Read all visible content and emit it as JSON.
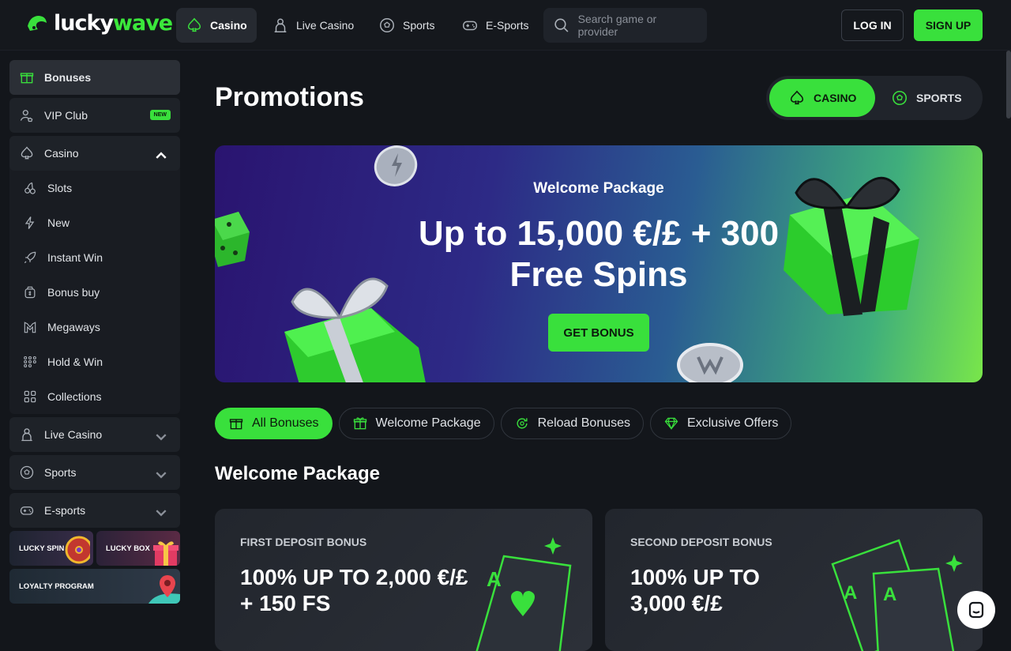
{
  "brand": {
    "name_part1": "lucky",
    "name_part2": "wave",
    "accent": "#39e03c"
  },
  "topnav": {
    "items": [
      {
        "label": "Casino",
        "icon": "spade-icon",
        "active": true
      },
      {
        "label": "Live Casino",
        "icon": "dealer-icon"
      },
      {
        "label": "Sports",
        "icon": "soccer-ball-icon"
      },
      {
        "label": "E-Sports",
        "icon": "gamepad-icon"
      }
    ],
    "search_placeholder": "Search game or provider",
    "login_label": "LOG IN",
    "signup_label": "SIGN UP"
  },
  "sidebar": {
    "bonuses": "Bonuses",
    "vip": "VIP Club",
    "vip_badge": "NEW",
    "casino": "Casino",
    "casino_sub": [
      "Slots",
      "New",
      "Instant Win",
      "Bonus buy",
      "Megaways",
      "Hold & Win",
      "Collections"
    ],
    "live_casino": "Live Casino",
    "sports": "Sports",
    "esports": "E-sports",
    "lucky_spin": "LUCKY SPIN",
    "lucky_box": "LUCKY BOX",
    "loyalty": "LOYALTY PROGRAM"
  },
  "main": {
    "title": "Promotions",
    "toggle": {
      "casino": "CASINO",
      "sports": "SPORTS"
    },
    "banner": {
      "subtitle": "Welcome Package",
      "headline_line1": "Up to 15,000 €/£ + 300",
      "headline_line2": "Free Spins",
      "cta": "GET BONUS"
    },
    "filters": [
      "All Bonuses",
      "Welcome Package",
      "Reload Bonuses",
      "Exclusive Offers"
    ],
    "section_title": "Welcome Package",
    "cards": [
      {
        "label": "FIRST DEPOSIT BONUS",
        "line1": "100% UP TO 2,000 €/£",
        "line2": "+ 150 FS"
      },
      {
        "label": "SECOND DEPOSIT BONUS",
        "line1": "100% UP TO",
        "line2": "3,000 €/£"
      }
    ]
  }
}
